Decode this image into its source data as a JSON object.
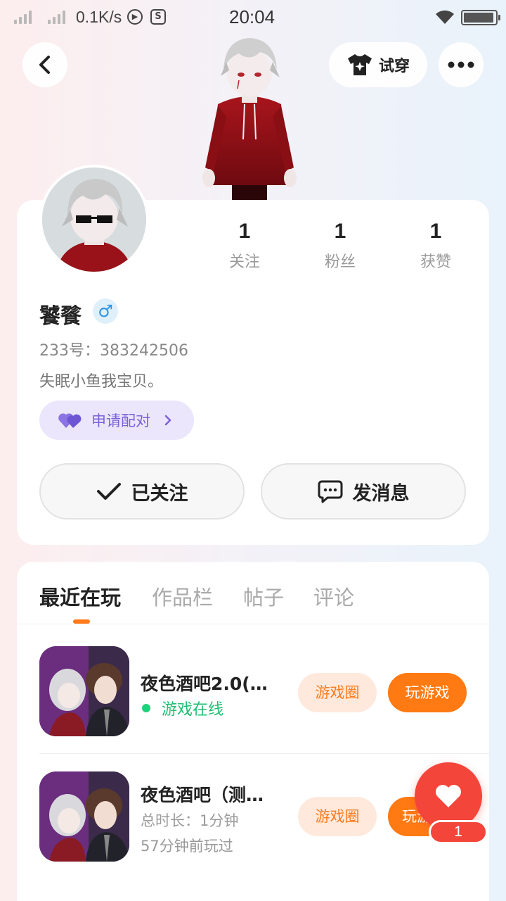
{
  "status_bar": {
    "net_speed": "0.1K/s",
    "time": "20:04"
  },
  "header": {
    "tryon_label": "试穿"
  },
  "profile": {
    "stats": [
      {
        "value": "1",
        "label": "关注"
      },
      {
        "value": "1",
        "label": "粉丝"
      },
      {
        "value": "1",
        "label": "获赞"
      }
    ],
    "username": "饕餮",
    "gender_symbol": "♂",
    "uid": "233号：383242506",
    "bio": "失眠小鱼我宝贝。",
    "match_label": "申请配对",
    "follow_label": "已关注",
    "message_label": "发消息"
  },
  "tabs": [
    "最近在玩",
    "作品栏",
    "帖子",
    "评论"
  ],
  "games": [
    {
      "title": "夜色酒吧2.0(…",
      "status": "游戏在线",
      "circle_label": "游戏圈",
      "play_label": "玩游戏"
    },
    {
      "title": "夜色酒吧（测…",
      "duration": "总时长：1分钟",
      "last_played": "57分钟前玩过",
      "circle_label": "游戏圈",
      "play_label": "玩游"
    }
  ],
  "floating": {
    "badge_count": "1"
  },
  "colors": {
    "accent": "#ff7a12",
    "online": "#1fbf73",
    "match": "#7a62d8",
    "heart": "#f4453a"
  }
}
